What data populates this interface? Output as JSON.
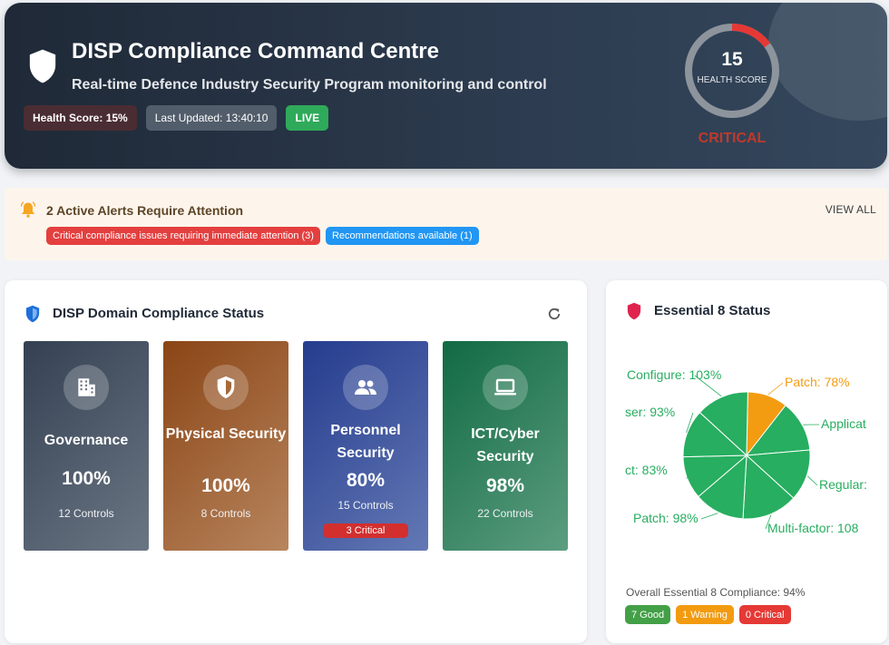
{
  "header": {
    "title": "DISP Compliance Command Centre",
    "subtitle": "Real-time Defence Industry Security Program monitoring and control",
    "health_chip": "Health Score: 15%",
    "updated_chip": "Last Updated: 13:40:10",
    "live_chip": "LIVE",
    "gauge": {
      "value": "15",
      "fraction": 0.15,
      "label": "HEALTH SCORE",
      "status": "CRITICAL",
      "status_color": "#c0392b"
    }
  },
  "alerts": {
    "title": "2 Active Alerts Require Attention",
    "view_all": "VIEW ALL",
    "tags": [
      {
        "text": "Critical compliance issues requiring immediate attention (3)",
        "color": "#e43f3f"
      },
      {
        "text": "Recommendations available (1)",
        "color": "#2196f3"
      }
    ]
  },
  "domain_panel": {
    "title": "DISP Domain Compliance Status",
    "cards": [
      {
        "name": "Governance",
        "percent": "100%",
        "controls": "12 Controls",
        "critical": "",
        "icon": "building-icon"
      },
      {
        "name": "Physical Security",
        "percent": "100%",
        "controls": "8 Controls",
        "critical": "",
        "icon": "shield-icon"
      },
      {
        "name": "Personnel Security",
        "percent": "80%",
        "controls": "15 Controls",
        "critical": "3 Critical",
        "icon": "people-icon"
      },
      {
        "name": "ICT/Cyber Security",
        "percent": "98%",
        "controls": "22 Controls",
        "critical": "",
        "icon": "laptop-icon"
      }
    ]
  },
  "e8_panel": {
    "title": "Essential 8 Status",
    "chart_data": {
      "type": "pie",
      "slices": [
        {
          "label": "Patch: 78%",
          "value": 78,
          "color": "#f39c12"
        },
        {
          "label": "Applicat",
          "value": 100,
          "color": "#27ae60"
        },
        {
          "label": "Regular:",
          "value": 100,
          "color": "#27ae60"
        },
        {
          "label": "Multi-factor: 108",
          "value": 108,
          "color": "#27ae60"
        },
        {
          "label": "Patch: 98%",
          "value": 98,
          "color": "#27ae60"
        },
        {
          "label": "ct: 83%",
          "value": 83,
          "color": "#27ae60"
        },
        {
          "label": "ser: 93%",
          "value": 93,
          "color": "#27ae60"
        },
        {
          "label": "Configure: 103%",
          "value": 103,
          "color": "#27ae60"
        }
      ]
    },
    "summary": "Overall Essential 8 Compliance: 94%",
    "tags": [
      {
        "text": "7 Good",
        "color": "#43a047"
      },
      {
        "text": "1 Warning",
        "color": "#f29b11"
      },
      {
        "text": "0 Critical",
        "color": "#e53935"
      }
    ]
  }
}
